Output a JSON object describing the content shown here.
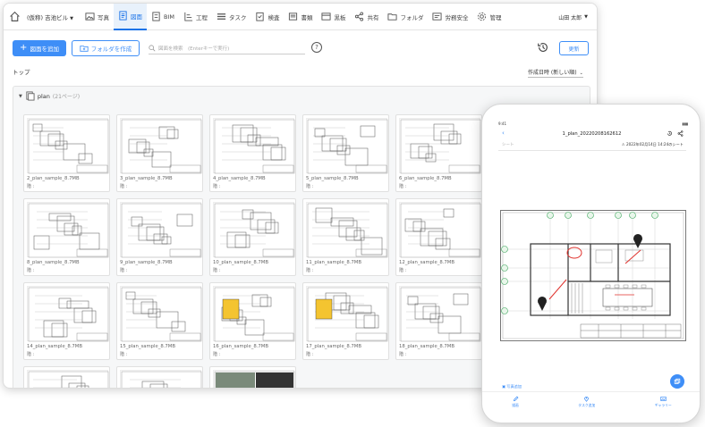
{
  "desktop": {
    "project_name": "(仮称) 吉池ビル",
    "nav": [
      {
        "label": "写真",
        "icon": "photo-icon"
      },
      {
        "label": "図面",
        "icon": "drawing-icon",
        "active": true
      },
      {
        "label": "BIM",
        "icon": "bim-icon"
      },
      {
        "label": "工程",
        "icon": "schedule-icon"
      },
      {
        "label": "タスク",
        "icon": "task-icon"
      },
      {
        "label": "検査",
        "icon": "inspection-icon"
      },
      {
        "label": "書類",
        "icon": "document-icon"
      },
      {
        "label": "黒板",
        "icon": "blackboard-icon"
      },
      {
        "label": "共有",
        "icon": "share-icon"
      },
      {
        "label": "フォルダ",
        "icon": "folder-icon"
      },
      {
        "label": "労務安全",
        "icon": "safety-icon"
      },
      {
        "label": "管理",
        "icon": "gear-icon"
      }
    ],
    "user_name": "山田 太郎",
    "toolbar": {
      "add_label": "図面を追加",
      "folder_label": "フォルダを作成",
      "search_placeholder": "図面を検索　(Enterキーで実行)",
      "help": "?",
      "refresh_label": "更新"
    },
    "breadcrumb": "トップ",
    "sort_label": "作成日時 (新しい順)",
    "folder": {
      "name": "plan",
      "count": "(21ページ)"
    },
    "cards": [
      {
        "name": "2_plan_sample_8.7MB",
        "sub": "階 :"
      },
      {
        "name": "3_plan_sample_8.7MB",
        "sub": "階 :"
      },
      {
        "name": "4_plan_sample_8.7MB",
        "sub": "階 :"
      },
      {
        "name": "5_plan_sample_8.7MB",
        "sub": "階 :"
      },
      {
        "name": "6_plan_sample_8.7MB",
        "sub": "階 :"
      },
      {
        "name": "8_plan_sample_8.7MB",
        "sub": "階 :"
      },
      {
        "name": "9_plan_sample_8.7MB",
        "sub": "階 :"
      },
      {
        "name": "10_plan_sample_8.7MB",
        "sub": "階 :"
      },
      {
        "name": "11_plan_sample_8.7MB",
        "sub": "階 :"
      },
      {
        "name": "12_plan_sample_8.7MB",
        "sub": "階 :"
      },
      {
        "name": "14_plan_sample_8.7MB",
        "sub": "階 :"
      },
      {
        "name": "15_plan_sample_8.7MB",
        "sub": "階 :"
      },
      {
        "name": "16_plan_sample_8.7MB",
        "sub": "階 :"
      },
      {
        "name": "17_plan_sample_8.7MB",
        "sub": "階 :"
      },
      {
        "name": "18_plan_sample_8.7MB",
        "sub": "階 :"
      },
      {
        "name": "",
        "sub": ""
      },
      {
        "name": "",
        "sub": ""
      },
      {
        "name": "",
        "sub": ""
      }
    ]
  },
  "phone": {
    "time": "9:41",
    "carrier": "",
    "battery": "",
    "title": "1_plan_20220208162612",
    "sheet": "シート",
    "date": "2022年02月14日 14:24のシート",
    "link": "写真追加",
    "tabs": [
      {
        "label": "描画"
      },
      {
        "label": "タスク追加"
      },
      {
        "label": "ギャラリー"
      }
    ]
  }
}
